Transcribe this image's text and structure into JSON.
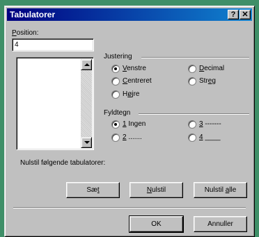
{
  "window": {
    "title": "Tabulatorer",
    "help_label": "?",
    "close_label": "✕"
  },
  "position": {
    "label_prefix": "P",
    "label_rest": "osition:",
    "value": "4"
  },
  "justering": {
    "heading": "Justering",
    "options": [
      {
        "pre": "",
        "key": "V",
        "rest": "enstre",
        "selected": true
      },
      {
        "pre": "",
        "key": "C",
        "rest": "entreret",
        "selected": false
      },
      {
        "pre": "H",
        "key": "ø",
        "rest": "jre",
        "selected": false
      },
      {
        "pre": "",
        "key": "D",
        "rest": "ecimal",
        "selected": false
      },
      {
        "pre": "Str",
        "key": "e",
        "rest": "g",
        "selected": false
      }
    ]
  },
  "fyldtegn": {
    "heading": "Fyldtegn",
    "options": [
      {
        "key": "1",
        "rest": " Ingen",
        "selected": true
      },
      {
        "key": "2",
        "rest": " .......",
        "selected": false
      },
      {
        "key": "3",
        "rest": " -------",
        "selected": false
      },
      {
        "key": "4",
        "rest": " ____",
        "selected": false
      }
    ]
  },
  "clear_label": "Nulstil følgende tabulatorer:",
  "buttons": {
    "set_pre": "Sæ",
    "set_key": "t",
    "reset_pre": "",
    "reset_key": "N",
    "reset_rest": "ulstil",
    "reset_all_pre": "Nulstil ",
    "reset_all_key": "a",
    "reset_all_rest": "lle",
    "ok": "OK",
    "cancel": "Annuller"
  }
}
